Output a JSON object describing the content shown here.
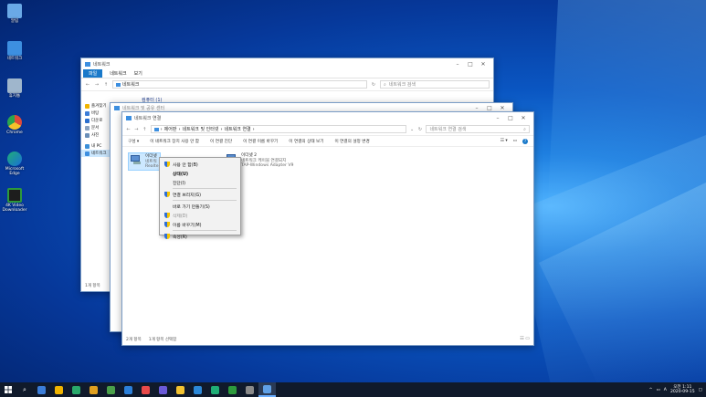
{
  "desktop": {
    "icons": [
      {
        "label": "알림",
        "color": "#6aa9e6"
      },
      {
        "label": "네트워크",
        "color": "#3d8fe0"
      },
      {
        "label": "휴지통",
        "color": "#9fb6cc"
      },
      {
        "label": "Chrome",
        "color": "#e04a3a"
      },
      {
        "label": "Microsoft Edge",
        "color": "#1fae76"
      },
      {
        "label": "4K Video Downloader",
        "color": "#2d9a3c"
      }
    ]
  },
  "network_window": {
    "title": "네트워크",
    "tabs": [
      "파일",
      "네트워크",
      "보기"
    ],
    "address": "네트워크",
    "search_placeholder": "네트워크 검색",
    "group_header": "컴퓨터 (1)",
    "sidebar": [
      "즐겨찾기",
      "바탕",
      "다운로",
      "문서",
      "사진",
      "내 PC",
      "네트워크"
    ],
    "status": "1개 항목"
  },
  "sharing_window": {
    "title": "네트워크 및 공유 센터"
  },
  "connections_window": {
    "title": "네트워크 연결",
    "breadcrumb": [
      "제어판",
      "네트워크 및 인터넷",
      "네트워크 연결"
    ],
    "search_placeholder": "네트워크 연결 검색",
    "commands": [
      "구성",
      "이 네트워크 장치 사용 안 함",
      "이 연결 진단",
      "이 연결 이름 바꾸기",
      "이 연결의 상태 보기",
      "이 연결의 설정 변경"
    ],
    "adapters": [
      {
        "name": "이더넷",
        "line2": "네트워",
        "line3": "Realte"
      },
      {
        "name": "이더넷 2",
        "line2": "네트워크 케이블 연결되지",
        "line3": "TAP-Windows Adapter V9"
      }
    ],
    "status": [
      "2개 항목",
      "1개 항목 선택함"
    ]
  },
  "context_menu": {
    "items": [
      {
        "label": "사용 안 함(B)",
        "shield": true,
        "bold": false,
        "disabled": false
      },
      {
        "label": "상태(U)",
        "shield": false,
        "bold": true,
        "disabled": false
      },
      {
        "label": "진단(I)",
        "shield": false,
        "bold": false,
        "disabled": false
      },
      {
        "label": "연결 브리지(G)",
        "shield": true,
        "bold": false,
        "disabled": false
      },
      {
        "label": "바로 가기 만들기(S)",
        "shield": false,
        "bold": false,
        "disabled": false
      },
      {
        "label": "삭제(D)",
        "shield": true,
        "bold": false,
        "disabled": true
      },
      {
        "label": "이름 바꾸기(M)",
        "shield": true,
        "bold": false,
        "disabled": false
      },
      {
        "label": "속성(R)",
        "shield": true,
        "bold": false,
        "disabled": false
      }
    ]
  },
  "taskbar": {
    "apps": [
      "#3b7dd8",
      "#f0b400",
      "#29a96b",
      "#e0a020",
      "#4aa04a",
      "#2b7fd9",
      "#e84a4a",
      "#6a5ad8",
      "#f2c230",
      "#2b88d8",
      "#1fae76",
      "#2d9a3c",
      "#8a8a8a",
      "#5fa0e6"
    ],
    "time": "오전 1:11",
    "date": "2020-09-15",
    "lang": "A"
  }
}
